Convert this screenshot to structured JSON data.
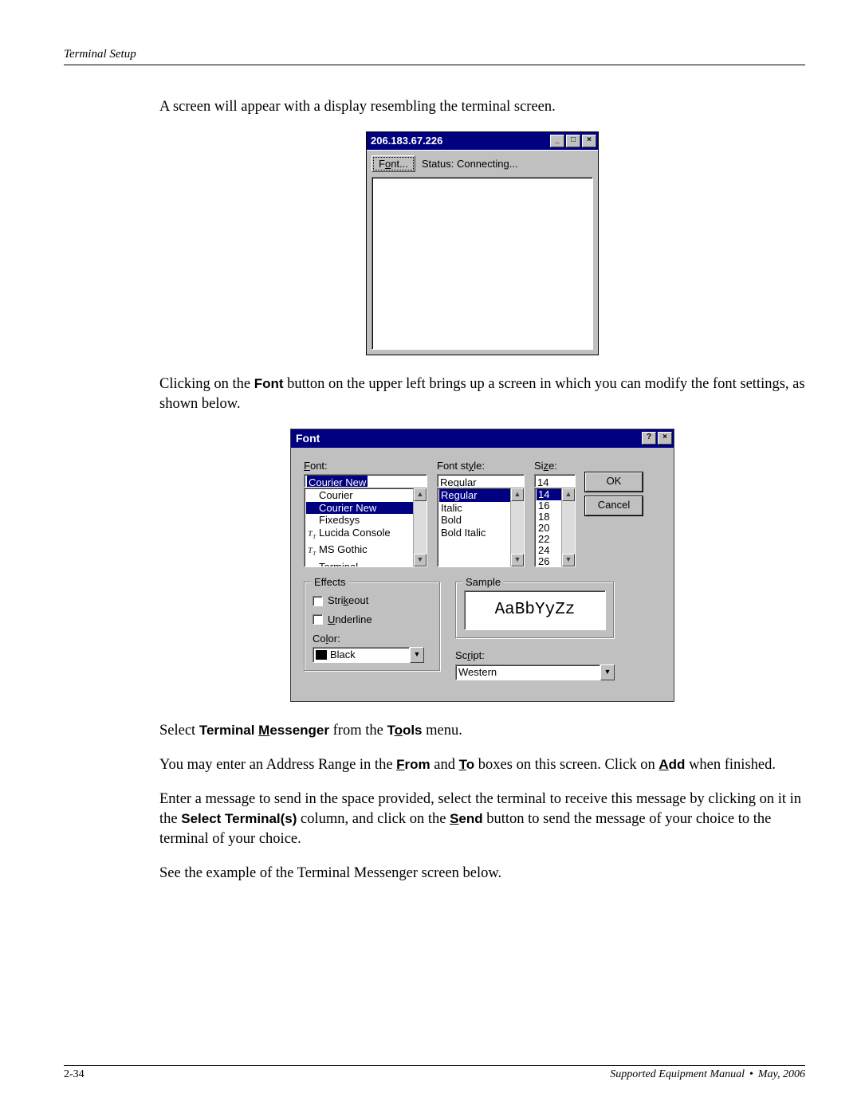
{
  "header": {
    "left": "Terminal Setup"
  },
  "body": {
    "p1": "A screen will appear with a display resembling the terminal screen.",
    "p2_a": "Clicking on the ",
    "p2_b": "Font",
    "p2_c": " button on the upper left brings up a screen in which you can modify the font settings, as shown below.",
    "p3_a": "Select ",
    "p3_b_pre": "Terminal ",
    "p3_b_u": "M",
    "p3_b_post": "essenger",
    "p3_c": " from the ",
    "p3_d_pre": "T",
    "p3_d_u": "o",
    "p3_d_post": "ols",
    "p3_e": " menu.",
    "p4_a": "You may enter an Address Range in the ",
    "p4_b_u": "F",
    "p4_b_post": "rom",
    "p4_c": " and ",
    "p4_d_u": "T",
    "p4_d_post": "o",
    "p4_e": " boxes on this screen. Click on ",
    "p4_f_u": "A",
    "p4_f_post": "dd",
    "p4_g": " when finished.",
    "p5_a": "Enter a message to send in the space provided, select the terminal to receive this message by clicking on it in the ",
    "p5_b": "Select Terminal(s)",
    "p5_c": " column, and click on the ",
    "p5_d_u": "S",
    "p5_d_post": "end",
    "p5_e": " button to send the message of your choice to the terminal of your choice.",
    "p6": "See the example of the Terminal Messenger screen below."
  },
  "win1": {
    "title": "206.183.67.226",
    "min": "_",
    "max": "□",
    "close": "×",
    "font_btn_pre": "F",
    "font_btn_u": "o",
    "font_btn_post": "nt...",
    "status": "Status: Connecting..."
  },
  "win2": {
    "title": "Font",
    "help": "?",
    "close": "×",
    "labels": {
      "font_pre": "F",
      "font_u": "o",
      "font_post": "nt:",
      "style_pre": "Font st",
      "style_u": "y",
      "style_post": "le:",
      "size_pre": "Si",
      "size_u": "z",
      "size_post": "e:",
      "effects": "Effects",
      "strike_pre": "Stri",
      "strike_u": "k",
      "strike_post": "eout",
      "under_u": "U",
      "under_post": "nderline",
      "color_pre": "Co",
      "color_u": "l",
      "color_post": "or:",
      "sample": "Sample",
      "script_pre": "Sc",
      "script_u": "r",
      "script_post": "ipt:"
    },
    "values": {
      "font": "Courier New",
      "style": "Regular",
      "size": "14",
      "color": "Black",
      "sample": "AaBbYyZz",
      "script": "Western"
    },
    "font_list": [
      "Courier",
      "Courier New",
      "Fixedsys",
      "Lucida Console",
      "MS Gothic",
      "Terminal"
    ],
    "font_list_tt": [
      false,
      false,
      false,
      true,
      true,
      false
    ],
    "font_selected_index": 1,
    "style_list": [
      "Regular",
      "Italic",
      "Bold",
      "Bold Italic"
    ],
    "style_selected_index": 0,
    "size_list": [
      "14",
      "16",
      "18",
      "20",
      "22",
      "24",
      "26"
    ],
    "size_selected_index": 0,
    "buttons": {
      "ok": "OK",
      "cancel": "Cancel"
    }
  },
  "footer": {
    "left": "2-34",
    "right_a": "Supported Equipment Manual",
    "right_b": "May, 2006",
    "bullet": "•"
  }
}
